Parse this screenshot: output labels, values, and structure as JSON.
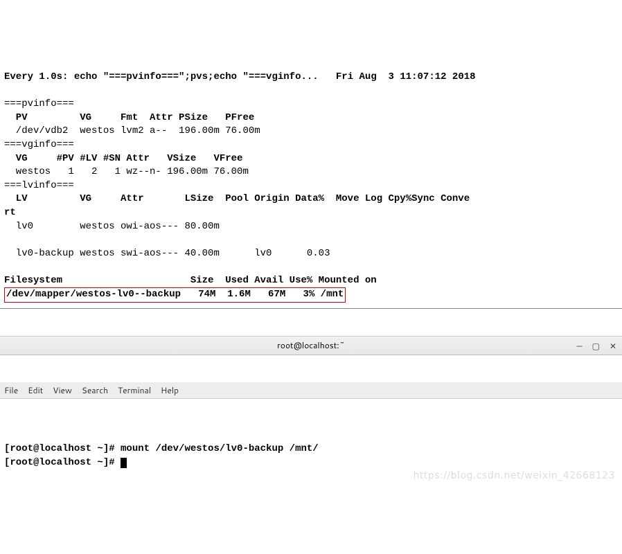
{
  "watch": {
    "header_left": "Every 1.0s: echo \"===pvinfo===\";pvs;echo \"===vginfo...",
    "header_right": "Fri Aug  3 11:07:12 2018"
  },
  "sections": {
    "pvinfo_marker": "===pvinfo===",
    "pv_header": "  PV         VG     Fmt  Attr PSize   PFree ",
    "pv_row": "  /dev/vdb2  westos lvm2 a--  196.00m 76.00m",
    "vginfo_marker": "===vginfo===",
    "vg_header": "  VG     #PV #LV #SN Attr   VSize   VFree ",
    "vg_row": "  westos   1   2   1 wz--n- 196.00m 76.00m",
    "lvinfo_marker": "===lvinfo===",
    "lv_header": "  LV         VG     Attr       LSize  Pool Origin Data%  Move Log Cpy%Sync Conve",
    "lv_header2": "rt",
    "lv_row1": "  lv0        westos owi-aos--- 80.00m",
    "lv_row2": "  lv0-backup westos swi-aos--- 40.00m      lv0      0.03",
    "df_header": "Filesystem                      Size  Used Avail Use% Mounted on",
    "df_row": "/dev/mapper/westos-lv0--backup   74M  1.6M   67M   3% /mnt"
  },
  "window": {
    "title": "root@localhost:~",
    "min": "—",
    "max": "▢",
    "close": "✕"
  },
  "menu": {
    "file": "File",
    "edit": "Edit",
    "view": "View",
    "search": "Search",
    "terminal": "Terminal",
    "help": "Help"
  },
  "term": {
    "prompt": "[root@localhost ~]# ",
    "cmd": "mount /dev/westos/lv0-backup /mnt/",
    "prompt2": "[root@localhost ~]# "
  },
  "watermark": "https://blog.csdn.net/weixin_42668123"
}
